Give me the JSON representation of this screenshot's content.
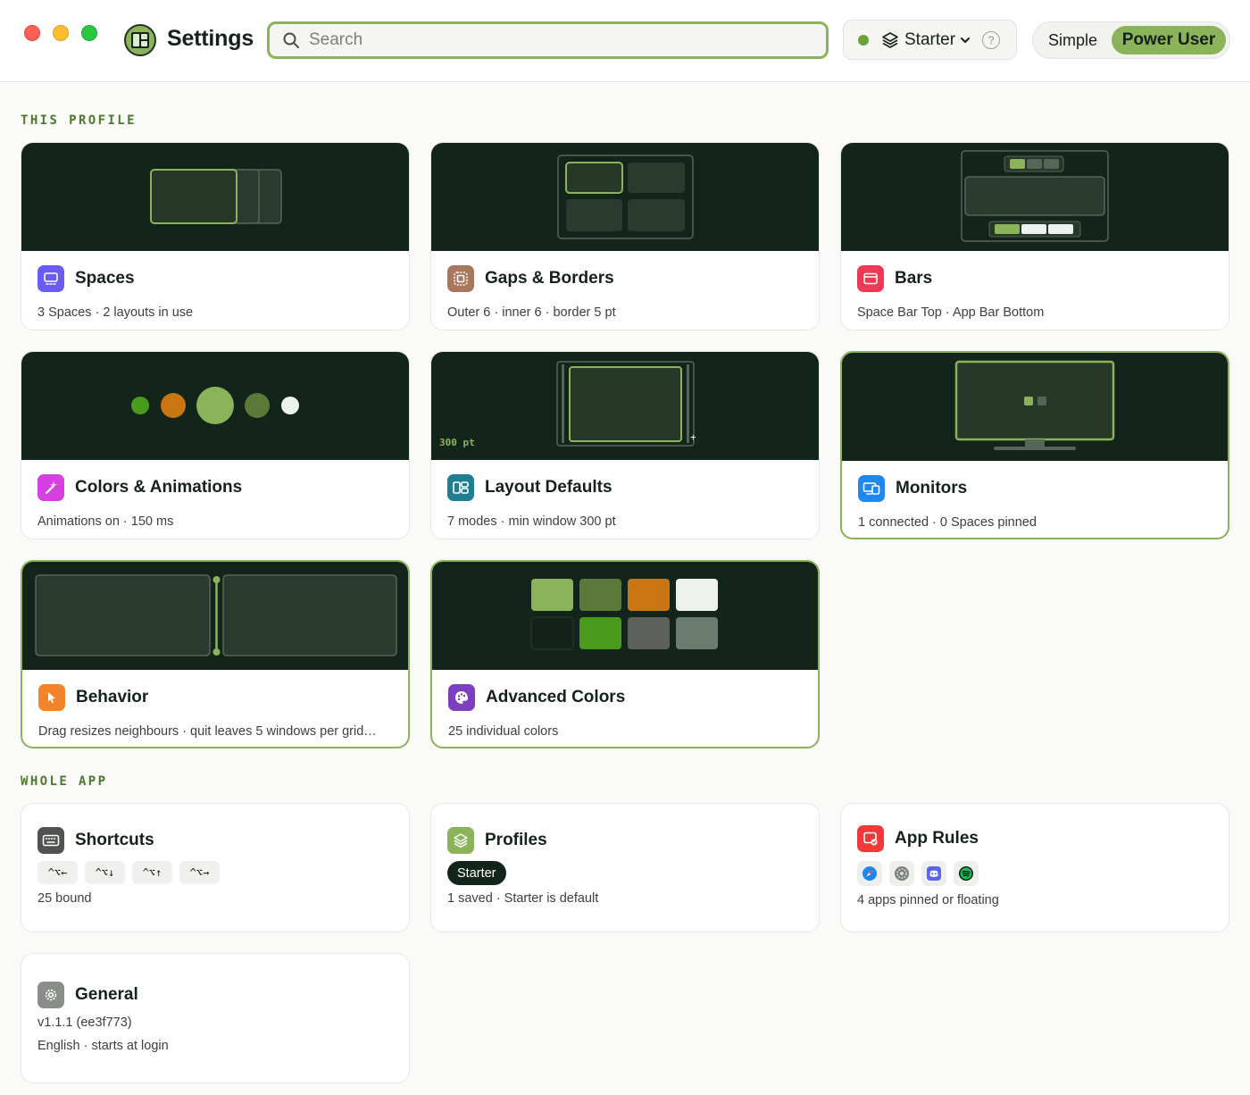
{
  "window": {
    "title": "Settings",
    "search_placeholder": "Search",
    "profile_selector": {
      "name": "Starter",
      "status": "active",
      "help_icon": "?"
    },
    "mode": {
      "simple_label": "Simple",
      "power_label": "Power User",
      "selected": "Power User"
    }
  },
  "sections": {
    "this_profile": "THIS PROFILE",
    "whole_app": "WHOLE APP"
  },
  "cards": {
    "spaces": {
      "title": "Spaces",
      "subtitle": "3 Spaces · 2 layouts in use",
      "icon": "spaces-icon"
    },
    "gaps": {
      "title": "Gaps & Borders",
      "subtitle": "Outer 6 · inner 6 · border 5 pt",
      "icon": "gaps-icon"
    },
    "bars": {
      "title": "Bars",
      "subtitle": "Space Bar Top · App Bar Bottom",
      "icon": "bars-icon"
    },
    "colors": {
      "title": "Colors & Animations",
      "subtitle": "Animations on · 150 ms",
      "icon": "wand-icon"
    },
    "layout": {
      "title": "Layout Defaults",
      "subtitle": "7 modes · min window 300 pt",
      "preview_label": "300 pt",
      "icon": "layout-icon"
    },
    "monitors": {
      "title": "Monitors",
      "subtitle": "1 connected · 0 Spaces pinned",
      "icon": "monitor-icon"
    },
    "behavior": {
      "title": "Behavior",
      "subtitle": "Drag resizes neighbours · quit leaves 5 windows per grid…",
      "icon": "cursor-icon"
    },
    "advanced_colors": {
      "title": "Advanced Colors",
      "subtitle": "25 individual colors",
      "icon": "palette-icon"
    },
    "shortcuts": {
      "title": "Shortcuts",
      "subtitle": "25 bound",
      "keys": [
        "^⌥←",
        "^⌥↓",
        "^⌥↑",
        "^⌥→"
      ],
      "icon": "keyboard-icon"
    },
    "profiles": {
      "title": "Profiles",
      "subtitle": "1 saved · Starter is default",
      "chip": "Starter",
      "icon": "layers-icon"
    },
    "app_rules": {
      "title": "App Rules",
      "subtitle": "4 apps pinned or floating",
      "apps": [
        "safari-icon",
        "system-settings-icon",
        "discord-icon",
        "spotify-icon"
      ],
      "icon": "app-rules-icon"
    },
    "general": {
      "title": "General",
      "version": "v1.1.1 (ee3f773)",
      "subtitle": "English · starts at login",
      "icon": "gear-icon"
    }
  },
  "colors": {
    "accent": "#8bb359",
    "preview_bg": "#13241b",
    "palette": [
      "#8bb359",
      "#5b7a3a",
      "#c87512",
      "#eef2ee",
      "#15221a",
      "#4a9a1e",
      "#5e605e",
      "#6b7b70"
    ],
    "dots": [
      "#4a9a1e",
      "#c87512",
      "#8bb359",
      "#5b7a3a",
      "#eef2ee"
    ]
  }
}
